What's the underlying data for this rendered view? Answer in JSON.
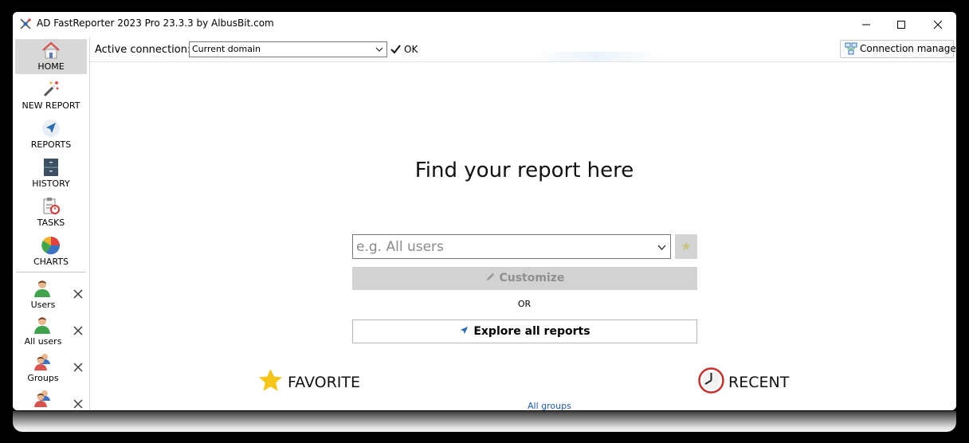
{
  "window": {
    "title": "AD FastReporter 2023 Pro 23.3.3 by AlbusBit.com",
    "controls": [
      "minimize",
      "maximize",
      "close"
    ]
  },
  "sidebar": {
    "nav": [
      {
        "label": "HOME",
        "icon": "home-icon",
        "active": true
      },
      {
        "label": "NEW REPORT",
        "icon": "magic-wand-icon",
        "active": false
      },
      {
        "label": "REPORTS",
        "icon": "navigation-arrow-icon",
        "active": false
      },
      {
        "label": "HISTORY",
        "icon": "cabinet-icon",
        "active": false
      },
      {
        "label": "TASKS",
        "icon": "task-clipboard-icon",
        "active": false
      },
      {
        "label": "CHARTS",
        "icon": "pie-chart-icon",
        "active": false
      }
    ],
    "recent_reports": [
      {
        "label": "Users",
        "icon": "user-icon"
      },
      {
        "label": "All users",
        "icon": "user-icon"
      },
      {
        "label": "Groups",
        "icon": "group-icon"
      },
      {
        "label": "",
        "icon": "group-icon"
      }
    ]
  },
  "topbar": {
    "connection_label": "Active connection:",
    "connection_value": "Current domain",
    "status_text": "OK",
    "connection_manager_label": "Connection manager"
  },
  "main": {
    "headline": "Find your report here",
    "search_placeholder": "e.g. All users",
    "customize_label": "Customize",
    "or_text": "OR",
    "explore_label": "Explore all reports",
    "favorite_label": "FAVORITE",
    "recent_label": "RECENT",
    "favorite_items": [
      "All groups"
    ]
  },
  "colors": {
    "accent_star": "#f5c518",
    "link": "#1a5bbf",
    "disabled_button": "#d2d2d2",
    "active_nav": "#d8d8d8"
  }
}
